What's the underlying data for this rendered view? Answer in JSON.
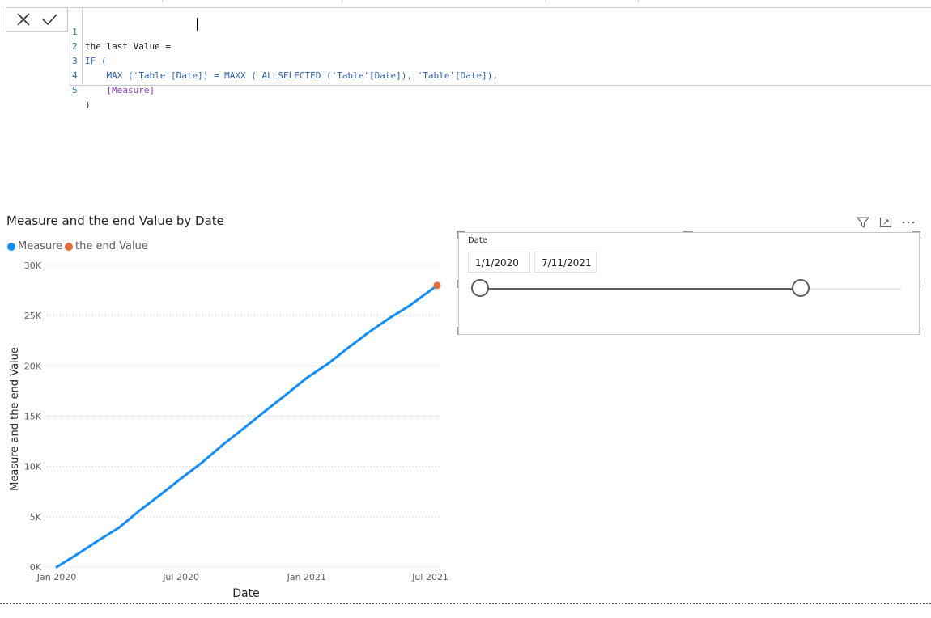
{
  "formula": {
    "cancel_icon": "close-icon",
    "commit_icon": "check-icon",
    "lines": [
      {
        "num": "1",
        "text": "the last Value ="
      },
      {
        "num": "2",
        "text": "IF ("
      },
      {
        "num": "3",
        "text": "    MAX ('Table'[Date]) = MAXX ( ALLSELECTED ('Table'[Date]), 'Table'[Date]),"
      },
      {
        "num": "4",
        "text": "    [Measure]"
      },
      {
        "num": "5",
        "text": ")"
      }
    ]
  },
  "chart": {
    "title": "Measure and the end Value by Date",
    "legend": [
      {
        "label": "Measure",
        "color": "#118DFF"
      },
      {
        "label": "the end Value",
        "color": "#E66C37"
      }
    ],
    "xlabel": "Date",
    "ylabel": "Measure and the end Value",
    "yticks": [
      "30K",
      "25K",
      "20K",
      "15K",
      "10K",
      "5K",
      "0K"
    ],
    "xticks": [
      "Jan 2020",
      "Jul 2020",
      "Jan 2021",
      "Jul 2021"
    ]
  },
  "chart_data": {
    "type": "line",
    "title": "Measure and the end Value by Date",
    "xlabel": "Date",
    "ylabel": "Measure and the end Value",
    "ylim": [
      0,
      30000
    ],
    "xlim": [
      "2020-01-01",
      "2021-07-11"
    ],
    "grid": true,
    "legend_position": "top-left",
    "series": [
      {
        "name": "Measure",
        "color": "#118DFF",
        "x": [
          "2020-01-01",
          "2020-02-01",
          "2020-03-01",
          "2020-04-01",
          "2020-05-01",
          "2020-06-01",
          "2020-07-01",
          "2020-08-01",
          "2020-09-01",
          "2020-10-01",
          "2020-11-01",
          "2020-12-01",
          "2021-01-01",
          "2021-02-01",
          "2021-03-01",
          "2021-04-01",
          "2021-05-01",
          "2021-06-01",
          "2021-07-01",
          "2021-07-11"
        ],
        "y": [
          0,
          1300,
          2600,
          3900,
          5600,
          7200,
          8800,
          10400,
          12200,
          13800,
          15500,
          17100,
          18800,
          20200,
          21700,
          23300,
          24700,
          26000,
          27500,
          28000
        ]
      },
      {
        "name": "the end Value",
        "color": "#E66C37",
        "x": [
          "2021-07-11"
        ],
        "y": [
          28000
        ]
      }
    ]
  },
  "slicer": {
    "title": "Date",
    "start": "1/1/2020",
    "end": "7/11/2021"
  },
  "header_icons": [
    "filter-icon",
    "focus-mode-icon",
    "more-options-icon"
  ]
}
